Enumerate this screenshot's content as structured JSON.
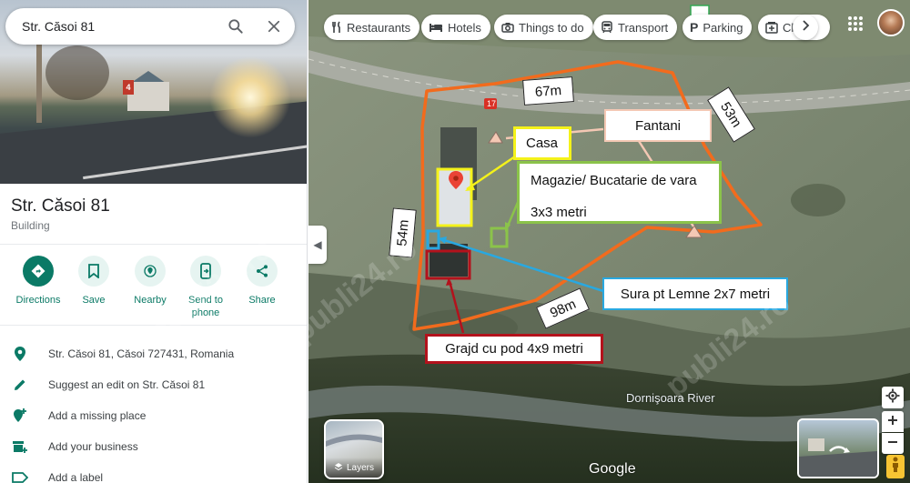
{
  "search": {
    "value": "Str. Căsoi 81"
  },
  "photo": {
    "sign": "4"
  },
  "place": {
    "title": "Str. Căsoi 81",
    "type": "Building"
  },
  "actions": [
    {
      "label": "Directions",
      "icon": "directions-icon"
    },
    {
      "label": "Save",
      "icon": "bookmark-icon"
    },
    {
      "label": "Nearby",
      "icon": "nearby-icon"
    },
    {
      "label": "Send to phone",
      "icon": "send-to-phone-icon"
    },
    {
      "label": "Share",
      "icon": "share-icon"
    }
  ],
  "info_rows": [
    {
      "text": "Str. Căsoi 81, Căsoi 727431, Romania",
      "icon": "location-pin-icon"
    },
    {
      "text": "Suggest an edit on Str. Căsoi 81",
      "icon": "pencil-icon"
    },
    {
      "text": "Add a missing place",
      "icon": "add-place-icon"
    },
    {
      "text": "Add your business",
      "icon": "business-icon"
    },
    {
      "text": "Add a label",
      "icon": "label-icon"
    }
  ],
  "chips": [
    {
      "label": "Restaurants",
      "icon": "restaurant-icon"
    },
    {
      "label": "Hotels",
      "icon": "hotel-icon"
    },
    {
      "label": "Things to do",
      "icon": "camera-icon"
    },
    {
      "label": "Transport",
      "icon": "transport-icon"
    },
    {
      "label": "Parking",
      "icon": "parking-icon"
    },
    {
      "label": "Cl",
      "icon": "pharmacy-icon"
    }
  ],
  "annotations": {
    "casa": "Casa",
    "fantani": "Fantani",
    "magazie_line1": "Magazie/ Bucatarie de vara",
    "magazie_line2": "3x3 metri",
    "sura": "Sura pt Lemne 2x7 metri",
    "grajd": "Grajd cu pod 4x9 metri",
    "dim_67": "67m",
    "dim_53": "53m",
    "dim_54": "54m",
    "dim_98": "98m"
  },
  "map": {
    "river": "Dornişoara River",
    "logo": "Google",
    "layers": "Layers",
    "road_number": "17",
    "watermark": "publi24.ro"
  },
  "colors": {
    "accent": "#0b7a66",
    "property_outline": "#f26b1d",
    "casa_box": "#f4f21a",
    "magazie_box": "#8bc34a",
    "sura_box": "#29a8e0",
    "grajd_box": "#b3121c",
    "fantani_box": "#f4c8b4"
  }
}
